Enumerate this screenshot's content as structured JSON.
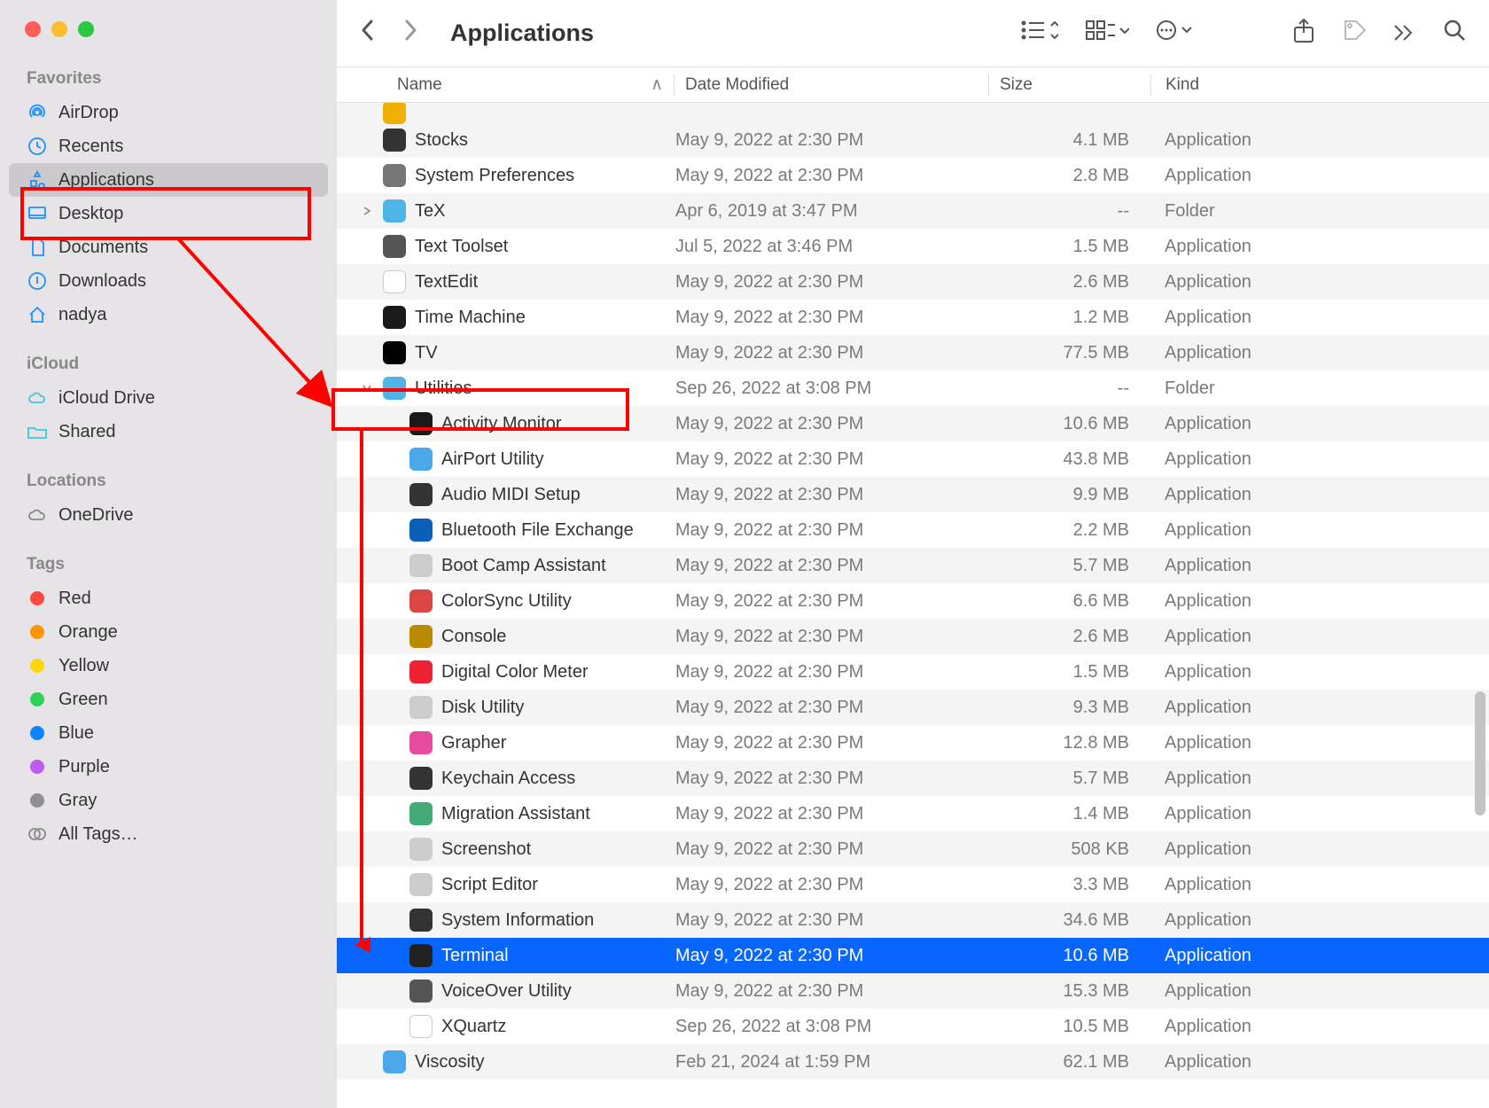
{
  "window_title": "Applications",
  "sidebar": {
    "sections": [
      {
        "label": "Favorites",
        "items": [
          {
            "icon": "airdrop",
            "label": "AirDrop",
            "color": "#1e90ff"
          },
          {
            "icon": "clock",
            "label": "Recents",
            "color": "#1e90ff"
          },
          {
            "icon": "apps",
            "label": "Applications",
            "color": "#1e90ff",
            "selected": true
          },
          {
            "icon": "desktop",
            "label": "Desktop",
            "color": "#1e90ff"
          },
          {
            "icon": "doc",
            "label": "Documents",
            "color": "#1e90ff"
          },
          {
            "icon": "download",
            "label": "Downloads",
            "color": "#1e90ff"
          },
          {
            "icon": "home",
            "label": "nadya",
            "color": "#1e90ff"
          }
        ]
      },
      {
        "label": "iCloud",
        "items": [
          {
            "icon": "cloud",
            "label": "iCloud Drive",
            "color": "#3ec6e0"
          },
          {
            "icon": "folder",
            "label": "Shared",
            "color": "#3ec6e0"
          }
        ]
      },
      {
        "label": "Locations",
        "items": [
          {
            "icon": "cloud2",
            "label": "OneDrive",
            "color": "#888"
          }
        ]
      },
      {
        "label": "Tags",
        "items": [
          {
            "tag": "#ff4a3d",
            "label": "Red"
          },
          {
            "tag": "#ff9500",
            "label": "Orange"
          },
          {
            "tag": "#ffd60a",
            "label": "Yellow"
          },
          {
            "tag": "#30d158",
            "label": "Green"
          },
          {
            "tag": "#0a84ff",
            "label": "Blue"
          },
          {
            "tag": "#bf5af2",
            "label": "Purple"
          },
          {
            "tag": "#8e8e93",
            "label": "Gray"
          },
          {
            "icon": "alltags",
            "label": "All Tags…",
            "color": "#888"
          }
        ]
      }
    ]
  },
  "columns": {
    "name": "Name",
    "date": "Date Modified",
    "size": "Size",
    "kind": "Kind"
  },
  "rows": [
    {
      "indent": 0,
      "disc": "",
      "icon": "#333",
      "name": "Stocks",
      "date": "May 9, 2022 at 2:30 PM",
      "size": "4.1 MB",
      "kind": "Application"
    },
    {
      "indent": 0,
      "disc": "",
      "icon": "#777",
      "name": "System Preferences",
      "date": "May 9, 2022 at 2:30 PM",
      "size": "2.8 MB",
      "kind": "Application"
    },
    {
      "indent": 0,
      "disc": ">",
      "icon": "#4fb4e8",
      "name": "TeX",
      "date": "Apr 6, 2019 at 3:47 PM",
      "size": "--",
      "kind": "Folder"
    },
    {
      "indent": 0,
      "disc": "",
      "icon": "#555",
      "name": "Text Toolset",
      "date": "Jul 5, 2022 at 3:46 PM",
      "size": "1.5 MB",
      "kind": "Application"
    },
    {
      "indent": 0,
      "disc": "",
      "icon": "#fff",
      "name": "TextEdit",
      "date": "May 9, 2022 at 2:30 PM",
      "size": "2.6 MB",
      "kind": "Application",
      "iconBorder": true
    },
    {
      "indent": 0,
      "disc": "",
      "icon": "#1a1a1a",
      "name": "Time Machine",
      "date": "May 9, 2022 at 2:30 PM",
      "size": "1.2 MB",
      "kind": "Application"
    },
    {
      "indent": 0,
      "disc": "",
      "icon": "#000",
      "name": "TV",
      "date": "May 9, 2022 at 2:30 PM",
      "size": "77.5 MB",
      "kind": "Application"
    },
    {
      "indent": 0,
      "disc": "v",
      "icon": "#4fb4e8",
      "name": "Utilities",
      "date": "Sep 26, 2022 at 3:08 PM",
      "size": "--",
      "kind": "Folder",
      "highlight": true
    },
    {
      "indent": 1,
      "disc": "",
      "icon": "#1a1a1a",
      "name": "Activity Monitor",
      "date": "May 9, 2022 at 2:30 PM",
      "size": "10.6 MB",
      "kind": "Application"
    },
    {
      "indent": 1,
      "disc": "",
      "icon": "#4aa8e8",
      "name": "AirPort Utility",
      "date": "May 9, 2022 at 2:30 PM",
      "size": "43.8 MB",
      "kind": "Application"
    },
    {
      "indent": 1,
      "disc": "",
      "icon": "#333",
      "name": "Audio MIDI Setup",
      "date": "May 9, 2022 at 2:30 PM",
      "size": "9.9 MB",
      "kind": "Application"
    },
    {
      "indent": 1,
      "disc": "",
      "icon": "#0a5fb8",
      "name": "Bluetooth File Exchange",
      "date": "May 9, 2022 at 2:30 PM",
      "size": "2.2 MB",
      "kind": "Application"
    },
    {
      "indent": 1,
      "disc": "",
      "icon": "#ccc",
      "name": "Boot Camp Assistant",
      "date": "May 9, 2022 at 2:30 PM",
      "size": "5.7 MB",
      "kind": "Application"
    },
    {
      "indent": 1,
      "disc": "",
      "icon": "#d44",
      "name": "ColorSync Utility",
      "date": "May 9, 2022 at 2:30 PM",
      "size": "6.6 MB",
      "kind": "Application"
    },
    {
      "indent": 1,
      "disc": "",
      "icon": "#bb8a00",
      "name": "Console",
      "date": "May 9, 2022 at 2:30 PM",
      "size": "2.6 MB",
      "kind": "Application"
    },
    {
      "indent": 1,
      "disc": "",
      "icon": "#e23",
      "name": "Digital Color Meter",
      "date": "May 9, 2022 at 2:30 PM",
      "size": "1.5 MB",
      "kind": "Application"
    },
    {
      "indent": 1,
      "disc": "",
      "icon": "#ccc",
      "name": "Disk Utility",
      "date": "May 9, 2022 at 2:30 PM",
      "size": "9.3 MB",
      "kind": "Application"
    },
    {
      "indent": 1,
      "disc": "",
      "icon": "#e84aa0",
      "name": "Grapher",
      "date": "May 9, 2022 at 2:30 PM",
      "size": "12.8 MB",
      "kind": "Application"
    },
    {
      "indent": 1,
      "disc": "",
      "icon": "#333",
      "name": "Keychain Access",
      "date": "May 9, 2022 at 2:30 PM",
      "size": "5.7 MB",
      "kind": "Application"
    },
    {
      "indent": 1,
      "disc": "",
      "icon": "#4a7",
      "name": "Migration Assistant",
      "date": "May 9, 2022 at 2:30 PM",
      "size": "1.4 MB",
      "kind": "Application"
    },
    {
      "indent": 1,
      "disc": "",
      "icon": "#ccc",
      "name": "Screenshot",
      "date": "May 9, 2022 at 2:30 PM",
      "size": "508 KB",
      "kind": "Application"
    },
    {
      "indent": 1,
      "disc": "",
      "icon": "#ccc",
      "name": "Script Editor",
      "date": "May 9, 2022 at 2:30 PM",
      "size": "3.3 MB",
      "kind": "Application"
    },
    {
      "indent": 1,
      "disc": "",
      "icon": "#333",
      "name": "System Information",
      "date": "May 9, 2022 at 2:30 PM",
      "size": "34.6 MB",
      "kind": "Application"
    },
    {
      "indent": 1,
      "disc": "",
      "icon": "#222",
      "name": "Terminal",
      "date": "May 9, 2022 at 2:30 PM",
      "size": "10.6 MB",
      "kind": "Application",
      "selected": true
    },
    {
      "indent": 1,
      "disc": "",
      "icon": "#555",
      "name": "VoiceOver Utility",
      "date": "May 9, 2022 at 2:30 PM",
      "size": "15.3 MB",
      "kind": "Application"
    },
    {
      "indent": 1,
      "disc": "",
      "icon": "#fff",
      "name": "XQuartz",
      "date": "Sep 26, 2022 at 3:08 PM",
      "size": "10.5 MB",
      "kind": "Application",
      "iconBorder": true
    },
    {
      "indent": 0,
      "disc": "",
      "icon": "#4aa8e8",
      "name": "Viscosity",
      "date": "Feb 21, 2024 at 1:59 PM",
      "size": "62.1 MB",
      "kind": "Application"
    }
  ]
}
